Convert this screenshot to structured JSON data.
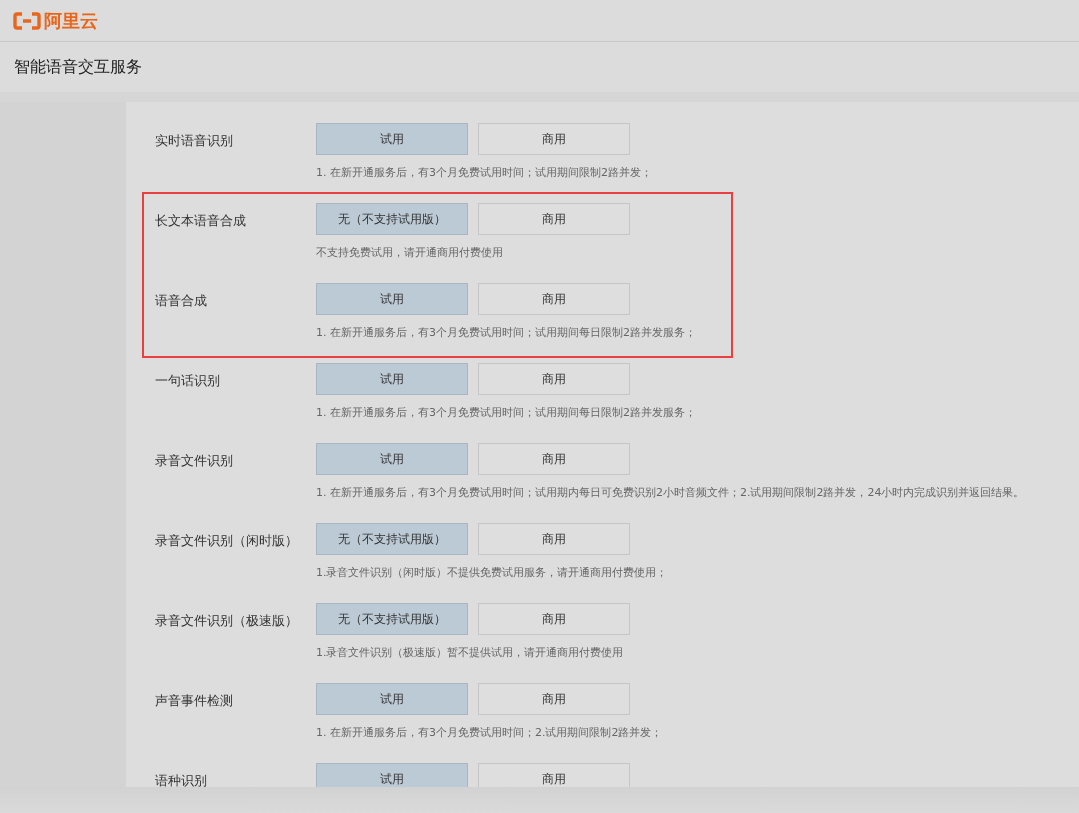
{
  "header": {
    "logo_text": "阿里云"
  },
  "page_title": "智能语音交互服务",
  "groups": [
    {
      "highlighted": false,
      "services": [
        {
          "name": "实时语音识别",
          "buttons": [
            {
              "label": "试用",
              "selected": true
            },
            {
              "label": "商用",
              "selected": false
            }
          ],
          "description": "1. 在新开通服务后，有3个月免费试用时间；试用期间限制2路并发；"
        }
      ]
    },
    {
      "highlighted": true,
      "services": [
        {
          "name": "长文本语音合成",
          "buttons": [
            {
              "label": "无（不支持试用版）",
              "selected": true
            },
            {
              "label": "商用",
              "selected": false
            }
          ],
          "description": "不支持免费试用，请开通商用付费使用"
        },
        {
          "name": "语音合成",
          "buttons": [
            {
              "label": "试用",
              "selected": true
            },
            {
              "label": "商用",
              "selected": false
            }
          ],
          "description": "1. 在新开通服务后，有3个月免费试用时间；试用期间每日限制2路并发服务；"
        }
      ]
    },
    {
      "highlighted": false,
      "services": [
        {
          "name": "一句话识别",
          "buttons": [
            {
              "label": "试用",
              "selected": true
            },
            {
              "label": "商用",
              "selected": false
            }
          ],
          "description": "1. 在新开通服务后，有3个月免费试用时间；试用期间每日限制2路并发服务；"
        },
        {
          "name": "录音文件识别",
          "buttons": [
            {
              "label": "试用",
              "selected": true
            },
            {
              "label": "商用",
              "selected": false
            }
          ],
          "description": "1. 在新开通服务后，有3个月免费试用时间；试用期内每日可免费识别2小时音频文件；2.试用期间限制2路并发，24小时内完成识别并返回结果。"
        },
        {
          "name": "录音文件识别（闲时版）",
          "buttons": [
            {
              "label": "无（不支持试用版）",
              "selected": true
            },
            {
              "label": "商用",
              "selected": false
            }
          ],
          "description": "1.录音文件识别（闲时版）不提供免费试用服务，请开通商用付费使用；"
        },
        {
          "name": "录音文件识别（极速版）",
          "buttons": [
            {
              "label": "无（不支持试用版）",
              "selected": true
            },
            {
              "label": "商用",
              "selected": false
            }
          ],
          "description": "1.录音文件识别（极速版）暂不提供试用，请开通商用付费使用"
        },
        {
          "name": "声音事件检测",
          "buttons": [
            {
              "label": "试用",
              "selected": true
            },
            {
              "label": "商用",
              "selected": false
            }
          ],
          "description": "1. 在新开通服务后，有3个月免费试用时间；2.试用期间限制2路并发；"
        },
        {
          "name": "语种识别",
          "buttons": [
            {
              "label": "试用",
              "selected": true
            },
            {
              "label": "商用",
              "selected": false
            }
          ]
        }
      ]
    }
  ]
}
